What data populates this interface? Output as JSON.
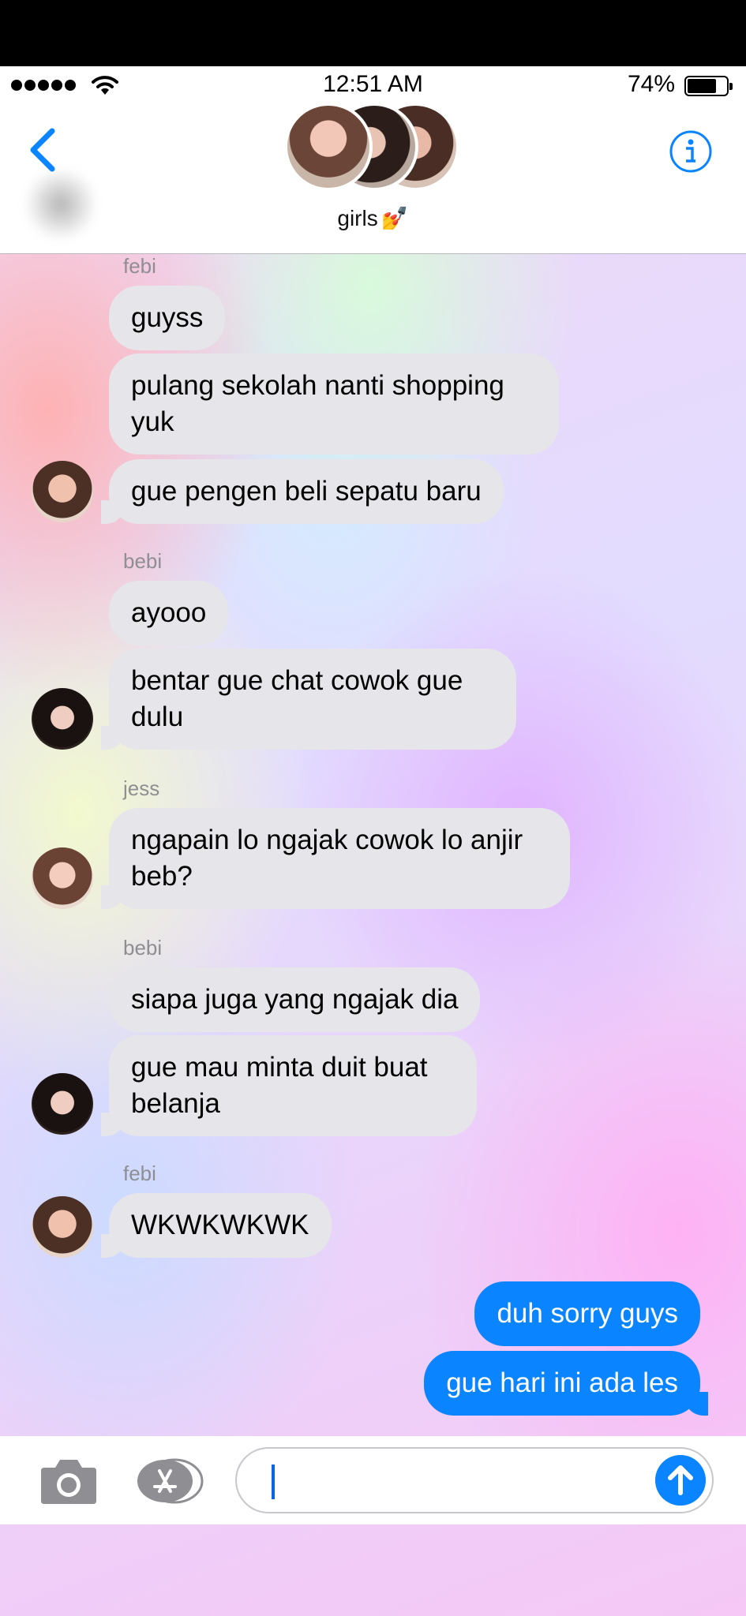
{
  "status_bar": {
    "time": "12:51 AM",
    "battery": "74%"
  },
  "header": {
    "group_name": "girls"
  },
  "messages": [
    {
      "sender": "febi"
    },
    {
      "text": "guyss"
    },
    {
      "text": "pulang sekolah nanti shopping yuk"
    },
    {
      "text": "gue pengen beli sepatu baru"
    },
    {
      "sender": "bebi"
    },
    {
      "text": "ayooo"
    },
    {
      "text": "bentar gue chat cowok gue dulu"
    },
    {
      "sender": "jess"
    },
    {
      "text": "ngapain lo ngajak cowok lo anjir beb?"
    },
    {
      "sender": "bebi"
    },
    {
      "text": "siapa juga yang ngajak dia"
    },
    {
      "text": "gue mau minta duit buat belanja"
    },
    {
      "sender": "febi"
    },
    {
      "text": "WKWKWKWK"
    },
    {
      "text": "duh sorry guys"
    },
    {
      "text": "gue hari ini ada les"
    }
  ],
  "colors": {
    "accent": "#0b84ff",
    "incoming_bubble": "#e5e5ea",
    "outgoing_bubble": "#0b84ff"
  },
  "icons": [
    "back-chevron-icon",
    "info-icon",
    "camera-icon",
    "app-store-icon",
    "send-arrow-icon",
    "nail-polish-icon",
    "wifi-icon"
  ]
}
